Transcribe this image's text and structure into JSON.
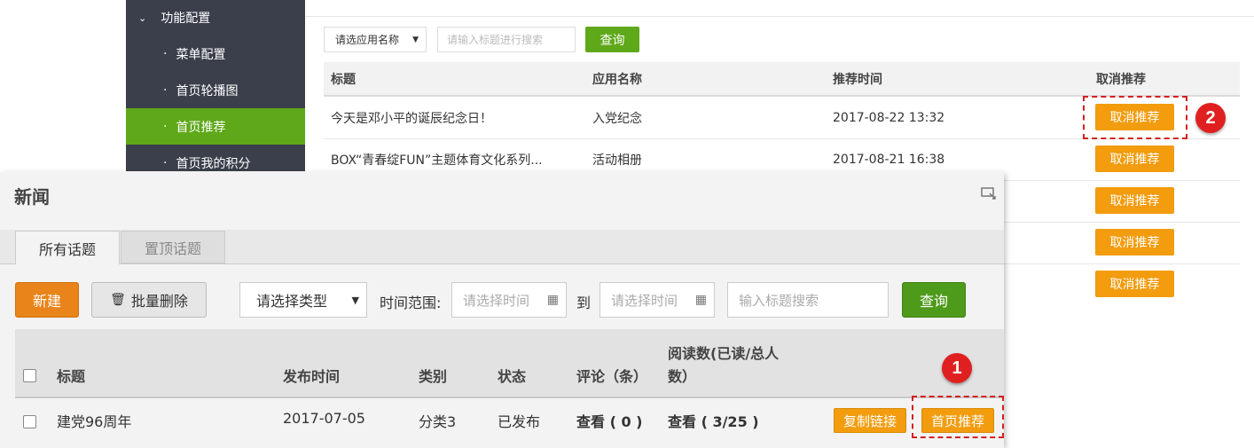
{
  "sidebar": {
    "header": "功能配置",
    "items": [
      "菜单配置",
      "首页轮播图",
      "首页推荐",
      "首页我的积分"
    ],
    "active_index": 2
  },
  "top_filter": {
    "app_select": "请选应用名称",
    "search_placeholder": "请输入标题进行搜索",
    "query": "查询"
  },
  "recommend_table": {
    "columns": [
      "标题",
      "应用名称",
      "推荐时间",
      "取消推荐"
    ],
    "rows": [
      {
        "title": "今天是邓小平的诞辰纪念日！",
        "app": "入党纪念",
        "time": "2017-08-22 13:32",
        "action": "取消推荐"
      },
      {
        "title": "BOX“青春绽FUN”主题体育文化系列...",
        "app": "活动相册",
        "time": "2017-08-21 16:38",
        "action": "取消推荐"
      }
    ],
    "extra_actions": [
      "取消推荐",
      "取消推荐",
      "取消推荐"
    ]
  },
  "badges": {
    "one": "1",
    "two": "2"
  },
  "news_panel": {
    "title": "新闻",
    "tabs": [
      "所有话题",
      "置顶话题"
    ],
    "toolbar": {
      "new": "新建",
      "batch_delete": "批量删除",
      "type_select": "请选择类型",
      "time_range_label": "时间范围:",
      "start_placeholder": "请选择时间",
      "to": "到",
      "end_placeholder": "请选择时间",
      "search_placeholder": "输入标题搜索",
      "query": "查询"
    },
    "columns": {
      "title": "标题",
      "publish_time": "发布时间",
      "category": "类别",
      "status": "状态",
      "comments": "评论（条）",
      "reads_line1": "阅读数(已读/总人",
      "reads_line2": "数）"
    },
    "row": {
      "title": "建党96周年",
      "publish_time": "2017-07-05",
      "category": "分类3",
      "status": "已发布",
      "comments": "查看 ( 0 )",
      "reads": "查看 ( 3/25 )",
      "copy_link": "复制链接",
      "homepage_recommend": "首页推荐"
    }
  },
  "colors": {
    "green": "#5fa81a",
    "orange": "#f29c0e",
    "sidebar": "#3a3f4b",
    "highlight": "#d61f1f"
  }
}
